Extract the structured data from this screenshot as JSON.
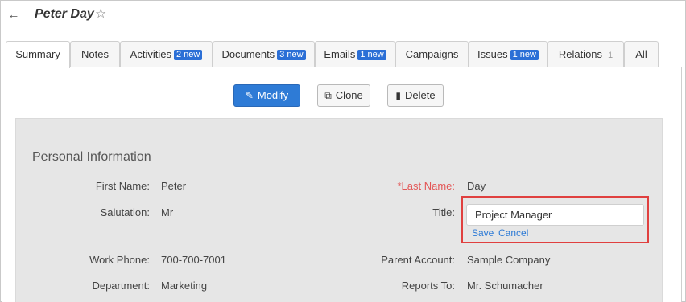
{
  "header": {
    "back_icon": "arrow-left-icon",
    "back_glyph": "←",
    "title": "Peter Day",
    "star_icon": "star-outline-icon",
    "star_glyph": "☆"
  },
  "tabs": [
    {
      "label": "Summary",
      "badge": "",
      "count": "",
      "active": true
    },
    {
      "label": "Notes",
      "badge": "",
      "count": ""
    },
    {
      "label": "Activities",
      "badge": "2 new",
      "count": ""
    },
    {
      "label": "Documents",
      "badge": "3 new",
      "count": ""
    },
    {
      "label": "Emails",
      "badge": "1 new",
      "count": ""
    },
    {
      "label": "Campaigns",
      "badge": "",
      "count": ""
    },
    {
      "label": "Issues",
      "badge": "1 new",
      "count": ""
    },
    {
      "label": "Relations",
      "badge": "",
      "count": "1"
    },
    {
      "label": "All",
      "badge": "",
      "count": ""
    }
  ],
  "toolbar": {
    "modify_label": "Modify",
    "modify_icon": "pencil-icon",
    "clone_label": "Clone",
    "clone_icon": "copy-icon",
    "delete_label": "Delete",
    "delete_icon": "trash-icon"
  },
  "section": {
    "title": "Personal Information"
  },
  "fields": {
    "first_name_label": "First Name:",
    "first_name_value": "Peter",
    "salutation_label": "Salutation:",
    "salutation_value": "Mr",
    "work_phone_label": "Work Phone:",
    "work_phone_value": "700-700-7001",
    "department_label": "Department:",
    "department_value": "Marketing",
    "last_name_label": "*Last Name:",
    "last_name_value": "Day",
    "title_label": "Title:",
    "title_value": "Project Manager",
    "parent_account_label": "Parent Account:",
    "parent_account_value": "Sample Company",
    "reports_to_label": "Reports To:",
    "reports_to_value": "Mr. Schumacher"
  },
  "inline_edit": {
    "save_label": "Save",
    "cancel_label": "Cancel"
  },
  "colors": {
    "accent": "#2e7bd6",
    "badge": "#2b6fd6",
    "highlight": "#e0403f",
    "required": "#e35656"
  }
}
